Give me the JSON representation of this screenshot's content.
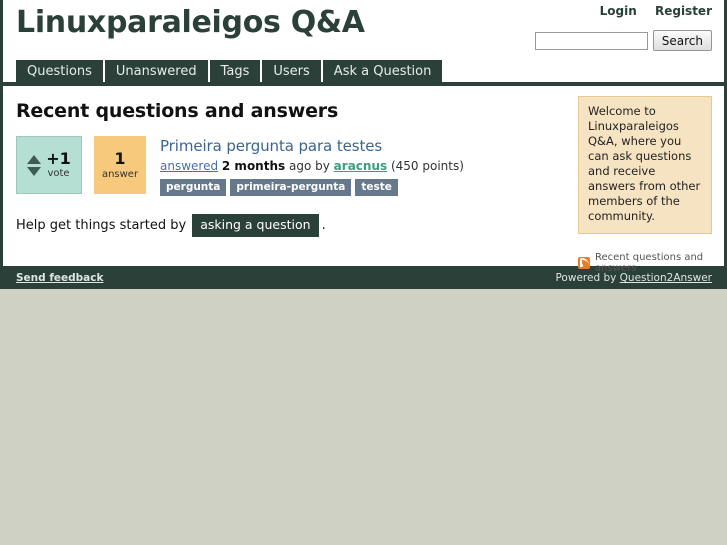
{
  "site": {
    "title": "Linuxparaleigos Q&A"
  },
  "header": {
    "login_label": "Login",
    "register_label": "Register",
    "search": {
      "value": "",
      "placeholder": "",
      "button_label": "Search"
    }
  },
  "nav": {
    "items": [
      {
        "label": "Questions",
        "name": "nav-item-questions"
      },
      {
        "label": "Unanswered",
        "name": "nav-item-unanswered"
      },
      {
        "label": "Tags",
        "name": "nav-item-tags"
      },
      {
        "label": "Users",
        "name": "nav-item-users"
      },
      {
        "label": "Ask a Question",
        "name": "nav-item-ask-a-question"
      }
    ]
  },
  "main": {
    "page_title": "Recent questions and answers",
    "questions": [
      {
        "vote_count": "+1",
        "vote_label": "vote",
        "answer_count": "1",
        "answer_label": "answer",
        "title": "Primeira pergunta para testes",
        "meta": {
          "status": "answered",
          "when": "2 months",
          "ago_by": "ago by",
          "user": "aracnus",
          "points": "(450 points)"
        },
        "tags": [
          "pergunta",
          "primeira-pergunta",
          "teste"
        ]
      }
    ],
    "help_text_before": "Help get things started by",
    "ask_link_label": "asking a question",
    "help_text_after": "."
  },
  "sidebar": {
    "welcome_text": "Welcome to Linuxparaleigos Q&A, where you can ask questions and receive answers from other members of the community.",
    "feed_label": "Recent questions and answers",
    "feed_icon": "rss-icon"
  },
  "footer": {
    "send_feedback_label": "Send feedback",
    "powered_by_text": "Powered by",
    "powered_by_link": "Question2Answer"
  },
  "colors": {
    "brand_dark": "#2b4039",
    "vote_box": "#b5dfd2",
    "answer_box": "#f6c97c",
    "welcome_box": "#f6e3c2",
    "tag": "#66798c",
    "link_blue": "#3a6591",
    "user_green": "#3c9f7c",
    "page_backdrop": "#ced1c4",
    "rss_orange": "#ef7a23"
  }
}
